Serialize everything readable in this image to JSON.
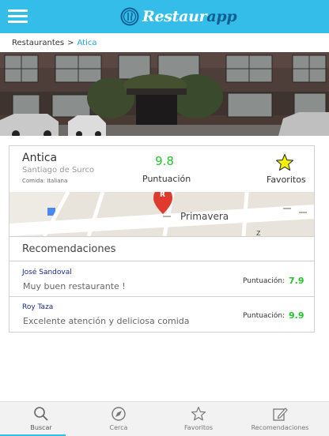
{
  "app": {
    "brand_first": "Restaur",
    "brand_second": "app"
  },
  "colors": {
    "topbar": "#35bde9",
    "accent": "#1aa4d8",
    "score_green": "#22c42a",
    "author_blue": "#1a2a8c"
  },
  "breadcrumb": {
    "parent": "Restaurantes",
    "separator": ">",
    "current": "Atica"
  },
  "restaurant": {
    "name": "Antica",
    "district": "Santiago de Surco",
    "food_type": "Comida: Italiana",
    "score": "9.8",
    "score_label": "Puntuación",
    "favorites_label": "Favoritos"
  },
  "map": {
    "street_label": "Primavera",
    "pin_letter": "R",
    "edge_label": "Z"
  },
  "recommendations": {
    "title": "Recomendaciones",
    "items": [
      {
        "author": "José Sandoval",
        "text": "Muy buen restaurante !",
        "score_label": "Puntuación:",
        "score": "7.9"
      },
      {
        "author": "Roy Taza",
        "text": "Excelente atención y deliciosa comida",
        "score_label": "Puntuación:",
        "score": "9.9"
      }
    ]
  },
  "bottom_nav": [
    {
      "label": "Buscar",
      "icon": "search-icon",
      "active": true
    },
    {
      "label": "Cerca",
      "icon": "compass-icon",
      "active": false
    },
    {
      "label": "Favoritos",
      "icon": "star-icon",
      "active": false
    },
    {
      "label": "Recomendaciones",
      "icon": "edit-icon",
      "active": false
    }
  ]
}
